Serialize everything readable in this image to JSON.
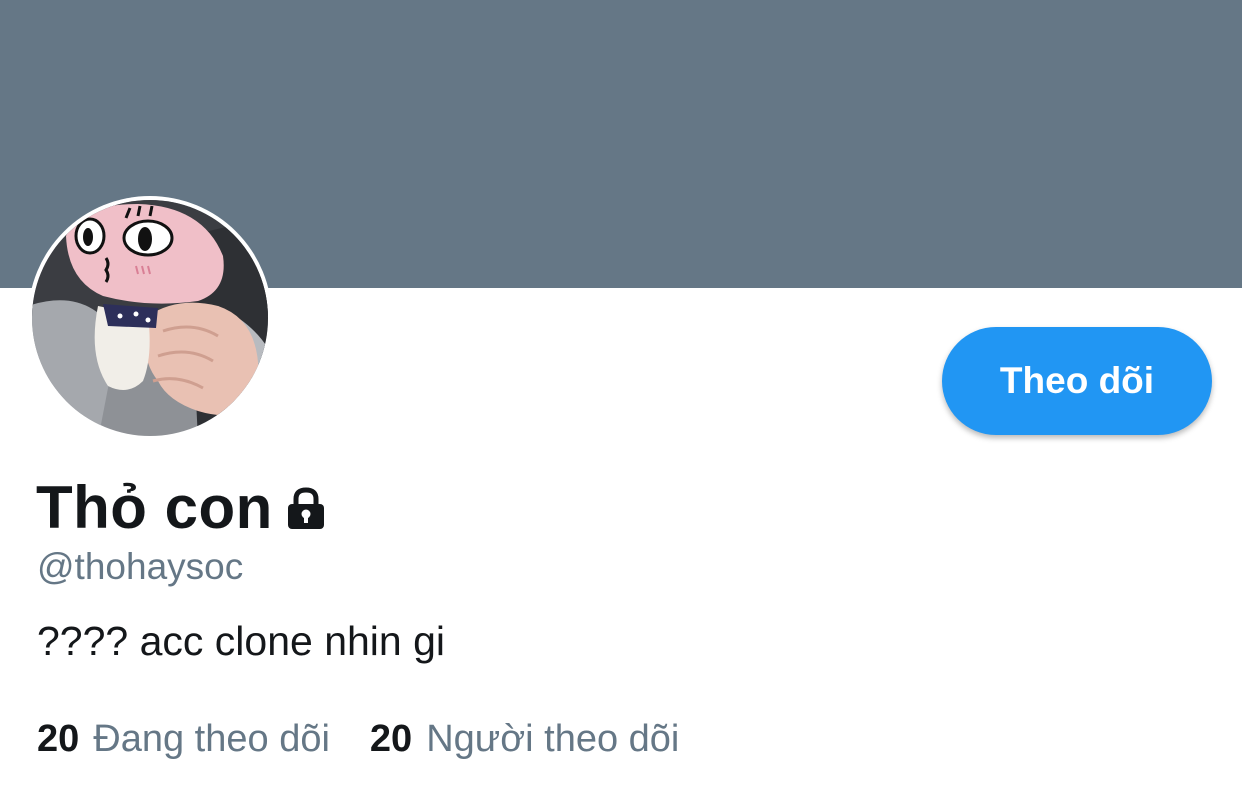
{
  "profile": {
    "display_name": "Thỏ con",
    "handle": "@thohaysoc",
    "bio": "???? acc clone nhin gi",
    "locked": true
  },
  "actions": {
    "follow_label": "Theo dõi"
  },
  "stats": {
    "following_count": "20",
    "following_label": "Đang theo dõi",
    "followers_count": "20",
    "followers_label": "Người theo dõi"
  },
  "icons": {
    "lock": "lock-icon"
  },
  "colors": {
    "banner": "#657786",
    "accent": "#2196f3",
    "text_primary": "#14171a",
    "text_secondary": "#657786"
  }
}
